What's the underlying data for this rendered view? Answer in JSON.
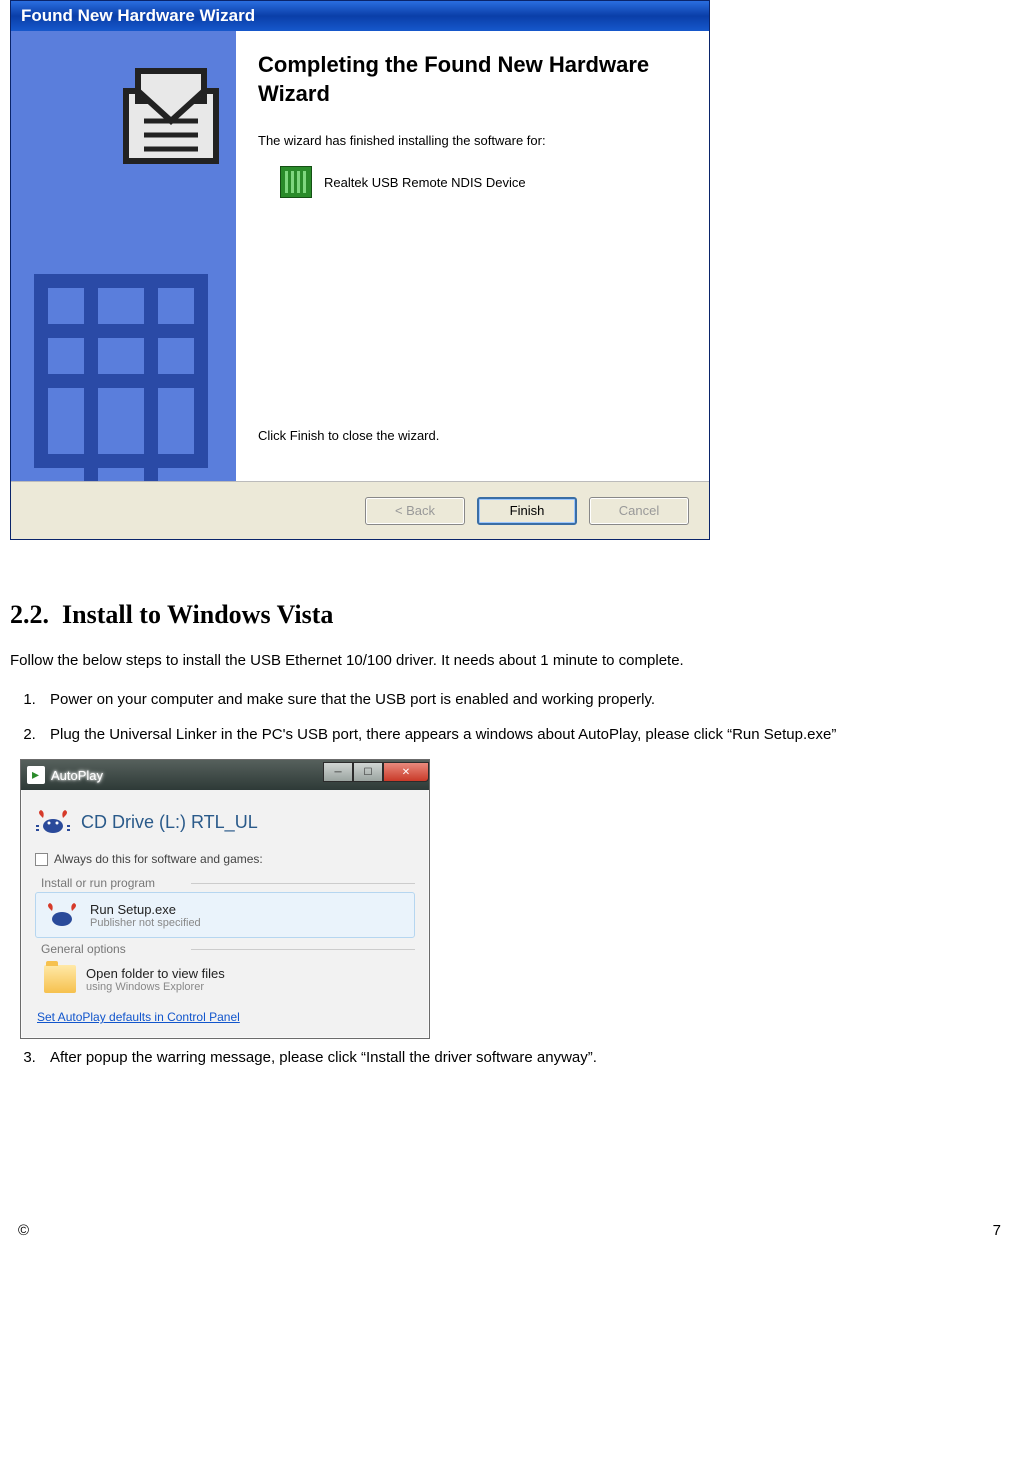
{
  "xp_wizard": {
    "title": "Found New Hardware Wizard",
    "heading": "Completing the Found New Hardware Wizard",
    "finished_text": "The wizard has finished installing the software for:",
    "device_name": "Realtek USB Remote NDIS Device",
    "close_hint": "Click Finish to close the wizard.",
    "buttons": {
      "back": "< Back",
      "finish": "Finish",
      "cancel": "Cancel"
    }
  },
  "doc": {
    "section_number": "2.2.",
    "section_title": "Install to Windows Vista",
    "intro": "Follow the below steps to install the USB Ethernet 10/100 driver. It needs about 1 minute to complete.",
    "steps": [
      "Power on your computer and make sure that the USB port is enabled and working properly.",
      "Plug the Universal Linker in the PC's USB port, there appears a windows about AutoPlay, please click “Run Setup.exe”",
      "After popup the warring message, please click “Install the driver software anyway”."
    ]
  },
  "vista": {
    "title": "AutoPlay",
    "drive_label": "CD Drive (L:) RTL_UL",
    "always_label": "Always do this for software and games:",
    "group_install": "Install or run program",
    "option_run_title": "Run Setup.exe",
    "option_run_sub": "Publisher not specified",
    "group_general": "General options",
    "option_folder_title": "Open folder to view files",
    "option_folder_sub": "using Windows Explorer",
    "defaults_link": "Set AutoPlay defaults in Control Panel",
    "winbtns": {
      "min": "─",
      "max": "☐",
      "close": "✕"
    }
  },
  "footer": {
    "copyright": "©",
    "page": "7"
  }
}
